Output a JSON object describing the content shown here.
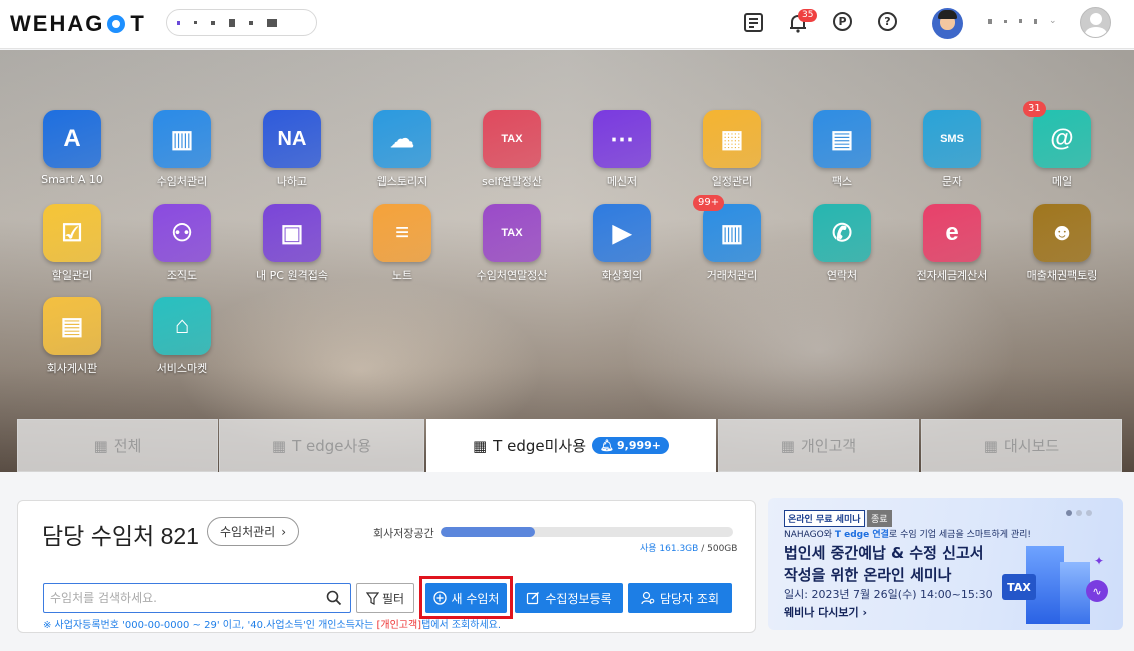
{
  "header": {
    "logo": "WEHAGO T",
    "notification_count": "35",
    "icons": [
      "board-icon",
      "bell-icon",
      "point-icon",
      "help-icon"
    ]
  },
  "apps": [
    {
      "label": "Smart A 10",
      "icon": "smart-a-icon",
      "color": "#1e6fe0",
      "badge": ""
    },
    {
      "label": "수임처관리",
      "icon": "buildings-icon",
      "color": "#2a8be8",
      "badge": ""
    },
    {
      "label": "나하고",
      "icon": "na-icon",
      "color": "#2e5bdc",
      "badge": ""
    },
    {
      "label": "웹스토리지",
      "icon": "cloud-drive-icon",
      "color": "#2b9ae0",
      "badge": ""
    },
    {
      "label": "self연말정산",
      "icon": "tax-receipt-icon",
      "color": "#e04a5e",
      "badge": ""
    },
    {
      "label": "메신저",
      "icon": "chat-bubble-icon",
      "color": "#7a3ae0",
      "badge": ""
    },
    {
      "label": "일정관리",
      "icon": "calendar-icon",
      "color": "#f5b431",
      "badge": ""
    },
    {
      "label": "팩스",
      "icon": "fax-icon",
      "color": "#2e8de4",
      "badge": ""
    },
    {
      "label": "문자",
      "icon": "sms-phone-icon",
      "color": "#2aa3d8",
      "badge": ""
    },
    {
      "label": "메일",
      "icon": "mail-icon",
      "color": "#23c2b0",
      "badge": "31"
    },
    {
      "label": "할일관리",
      "icon": "todo-list-icon",
      "color": "#f6c436",
      "badge": ""
    },
    {
      "label": "조직도",
      "icon": "org-chart-icon",
      "color": "#8a4ae0",
      "badge": ""
    },
    {
      "label": "내 PC 원격접속",
      "icon": "remote-pc-icon",
      "color": "#7a45d8",
      "badge": ""
    },
    {
      "label": "노트",
      "icon": "note-icon",
      "color": "#f5a23a",
      "badge": ""
    },
    {
      "label": "수임처연말정산",
      "icon": "tax-document-icon",
      "color": "#9a4ac8",
      "badge": ""
    },
    {
      "label": "화상회의",
      "icon": "video-call-icon",
      "color": "#2e7be0",
      "badge": ""
    },
    {
      "label": "거래처관리",
      "icon": "client-building-icon",
      "color": "#2a8de4",
      "badge": "99+"
    },
    {
      "label": "연락처",
      "icon": "contact-book-icon",
      "color": "#26b6b0",
      "badge": ""
    },
    {
      "label": "전자세금계산서",
      "icon": "e-tax-invoice-icon",
      "color": "#e8406a",
      "badge": ""
    },
    {
      "label": "매출채권팩토링",
      "icon": "toad-mascot-icon",
      "color": "#a0761e",
      "badge": ""
    },
    {
      "label": "회사게시판",
      "icon": "company-board-icon",
      "color": "#f4c040",
      "badge": ""
    },
    {
      "label": "서비스마켓",
      "icon": "store-icon",
      "color": "#28c0c0",
      "badge": ""
    }
  ],
  "tabs": [
    {
      "label": "전체",
      "active": false
    },
    {
      "label": "T edge사용",
      "active": false
    },
    {
      "label": "T edge미사용",
      "active": true,
      "count": "9,999+"
    },
    {
      "label": "개인고객",
      "active": false
    },
    {
      "label": "대시보드",
      "active": false
    }
  ],
  "card": {
    "title": "담당 수임처 821",
    "manage_button": "수임처관리",
    "storage_label": "회사저장공간",
    "storage_used_label": "사용 161.3GB",
    "storage_total": "/ 500GB",
    "storage_fraction": 0.3226,
    "search_placeholder": "수임처를 검색하세요.",
    "filter_label": "필터",
    "new_label": "새 수임처",
    "collect_label": "수집정보등록",
    "manager_label": "담당자 조회",
    "notice_prefix": "※ 사업자등록번호 '000-00-0000 ~ 29' 이고, '40.사업소득'인 개인소득자는 ",
    "notice_highlight": "[개인고객]",
    "notice_suffix": "탭에서 조회하세요."
  },
  "banner": {
    "tag_online": "온라인 무료 세미나",
    "tag_status": "종료",
    "sub_prefix": "NAHAGO와 ",
    "sub_bold": "T edge 연결",
    "sub_suffix": "로 수임 기업 세금을 스마트하게 관리!",
    "title_line1": "법인세 중간예납 & 수정 신고서",
    "title_line2": "작성을 위한 온라인 세미나",
    "date": "일시: 2023년 7월 26일(수) 14:00~15:30",
    "link": "웨비나 다시보기 ›",
    "tax_label": "TAX"
  }
}
